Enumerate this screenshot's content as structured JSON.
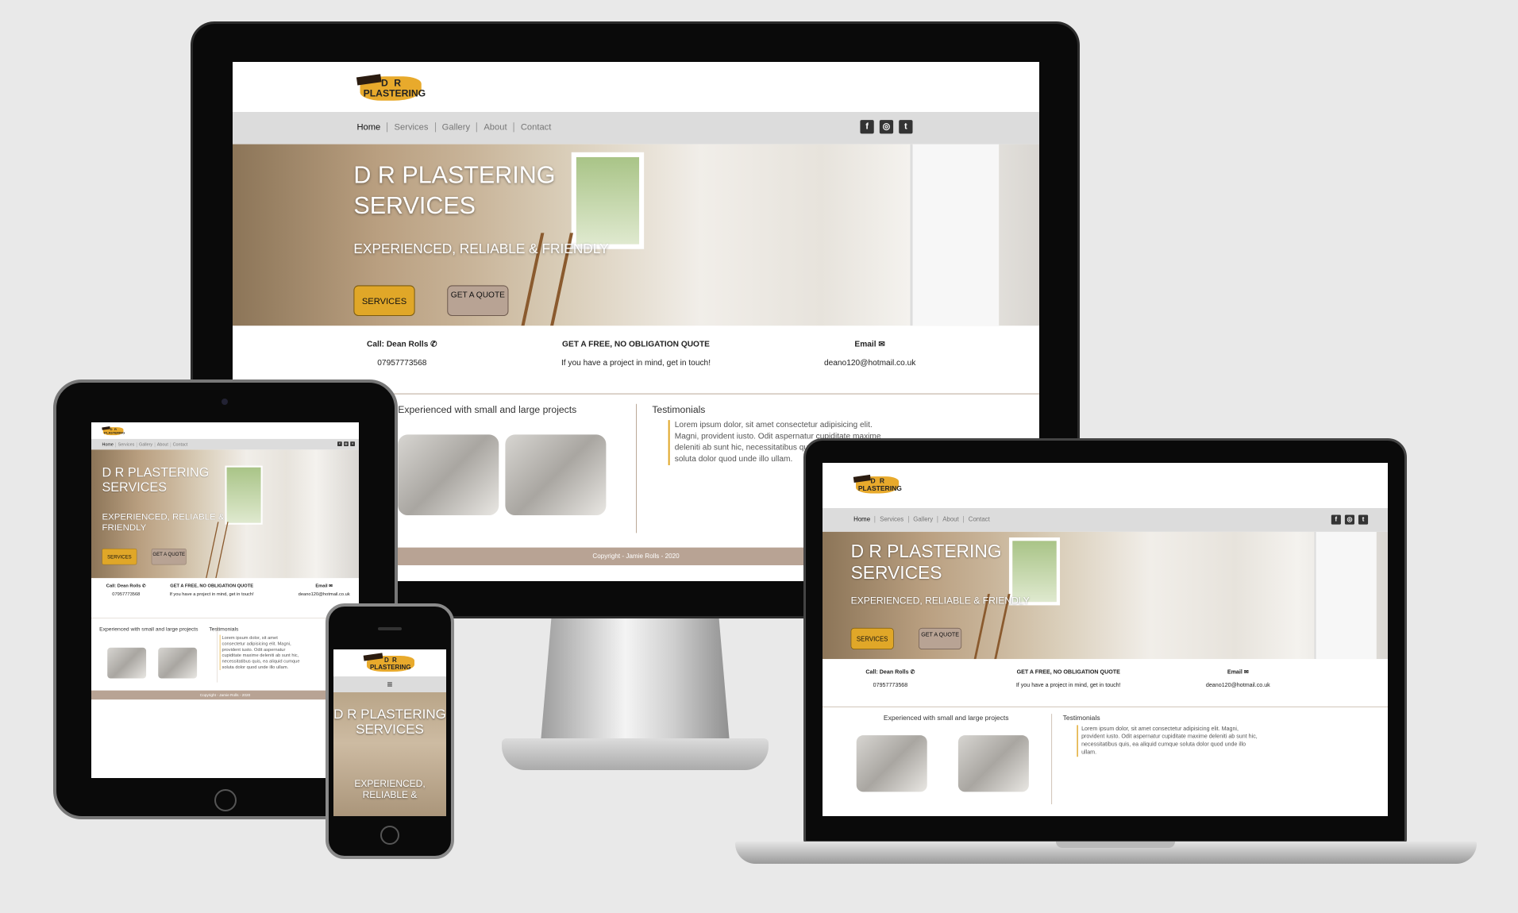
{
  "site": {
    "logo": {
      "line1": "D R",
      "line2": "PLASTERING"
    },
    "nav": [
      "Home",
      "Services",
      "Gallery",
      "About",
      "Contact"
    ],
    "social_icons": [
      "facebook-icon",
      "instagram-icon",
      "twitter-icon"
    ],
    "hero": {
      "title": "D R PLASTERING SERVICES",
      "tagline": "EXPERIENCED, RELIABLE & FRIENDLY",
      "services_button": "SERVICES",
      "quote_button": "GET A QUOTE"
    },
    "contact": {
      "call_label": "Call: Dean Rolls ✆",
      "phone": "07957773568",
      "quote_heading": "GET A FREE, NO OBLIGATION QUOTE",
      "quote_text": "If you have a project in mind, get in touch!",
      "email_label": "Email ✉",
      "email": "deano120@hotmail.co.uk"
    },
    "experience_title": "Experienced with small and large projects",
    "testimonials_title": "Testimonials",
    "testimonial_text": "Lorem ipsum dolor, sit amet consectetur adipisicing elit. Magni, provident iusto. Odit aspernatur cupiditate maxime deleniti ab sunt hic, necessitatibus quis, ea aliquid cumque soluta dolor quod unde illo ullam.",
    "footer": "Copyright - Jamie Rolls - 2020"
  },
  "mobile": {
    "menu_icon": "≡",
    "hero_title": "D R PLASTERING SERVICES",
    "hero_tagline": "EXPERIENCED, RELIABLE &"
  },
  "colors": {
    "accent": "#e0a728",
    "quote_button": "#b8a394",
    "footer": "#b8a394",
    "nav": "#dcdcdc"
  }
}
